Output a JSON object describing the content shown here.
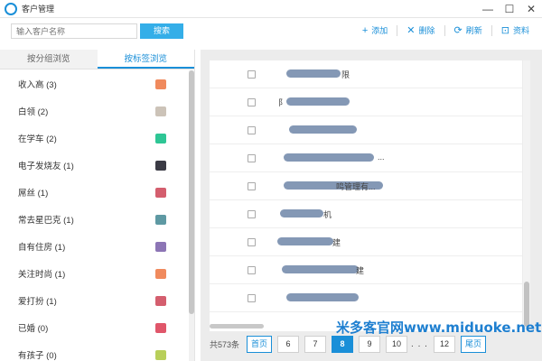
{
  "window": {
    "title": "客户管理",
    "app_icon": "eye-logo-icon",
    "minimize_glyph": "—",
    "maximize_glyph": "☐",
    "close_glyph": "✕"
  },
  "toolbar": {
    "search_placeholder": "输入客户名称",
    "search_label": "搜索",
    "add_icon": "+",
    "add_label": "添加",
    "delete_icon": "✕",
    "delete_label": "删除",
    "refresh_icon": "⟳",
    "refresh_label": "刷新",
    "profile_icon": "⊡",
    "profile_label": "资料"
  },
  "left_tabs": {
    "group": "按分组浏览",
    "tag": "按标签浏览"
  },
  "tags": [
    {
      "name": "收入高 (3)",
      "color": "#f08a5d"
    },
    {
      "name": "白领 (2)",
      "color": "#ccc3b8"
    },
    {
      "name": "在学车 (2)",
      "color": "#2ec695"
    },
    {
      "name": "电子发烧友 (1)",
      "color": "#3b3b45"
    },
    {
      "name": "屌丝 (1)",
      "color": "#d45e6e"
    },
    {
      "name": "常去星巴克 (1)",
      "color": "#5e99a3"
    },
    {
      "name": "自有住房 (1)",
      "color": "#8c75b5"
    },
    {
      "name": "关注时尚 (1)",
      "color": "#f08a5d"
    },
    {
      "name": "爱打扮 (1)",
      "color": "#d45e6e"
    },
    {
      "name": "已婚 (0)",
      "color": "#e0566a"
    },
    {
      "name": "有孩子 (0)",
      "color": "#b8cf5a"
    }
  ],
  "customers": [
    {
      "visible_text": "限"
    },
    {
      "visible_text": "阝"
    },
    {
      "visible_text": ""
    },
    {
      "visible_text": "..."
    },
    {
      "visible_text": "鸣管理有..."
    },
    {
      "visible_text": "机"
    },
    {
      "visible_text": "建"
    },
    {
      "visible_text": "建"
    },
    {
      "visible_text": ""
    }
  ],
  "pagination": {
    "total": "共573条",
    "first": "首页",
    "pages": [
      "6",
      "7",
      "8",
      "9",
      "10"
    ],
    "current": "8",
    "ellipsis": ". . .",
    "last_page": "12",
    "last": "尾页"
  },
  "watermark": "米多客官网www.miduoke.net"
}
